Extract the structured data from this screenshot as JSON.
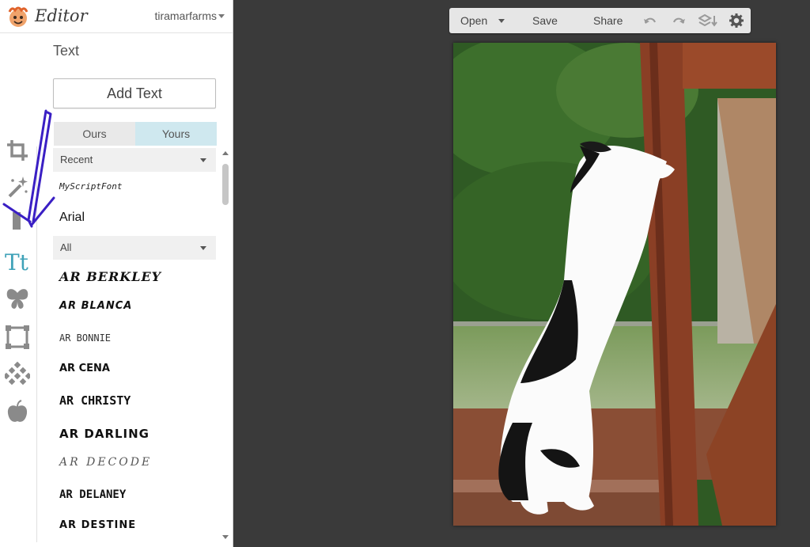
{
  "app": {
    "name": "Editor",
    "account": "tiramarfarms"
  },
  "rail": [
    "crop-icon",
    "magic-wand-icon",
    "pen-icon",
    "text-icon",
    "butterfly-icon",
    "frame-icon",
    "texture-icon",
    "apple-icon"
  ],
  "panel": {
    "title": "Text",
    "add_button": "Add Text",
    "tabs": {
      "ours": "Ours",
      "yours": "Yours",
      "active": "yours"
    },
    "recent_dropdown": "Recent",
    "recent_fonts": [
      "MyScriptFont",
      "Arial"
    ],
    "all_dropdown": "All",
    "fonts": [
      "AR BERKLEY",
      "AR BLANCA",
      "AR BONNIE",
      "AR CENA",
      "AR CHRISTY",
      "AR DARLING",
      "AR DECODE",
      "AR DELANEY",
      "AR DESTINE"
    ]
  },
  "toolbar": {
    "open": "Open",
    "save": "Save",
    "share": "Share"
  },
  "colors": {
    "accent_tab": "#cfe8ef",
    "canvas_bg": "#3a3a3a",
    "annotation_arrow": "#3a1fc4",
    "text_tool": "#3fa2b8"
  }
}
